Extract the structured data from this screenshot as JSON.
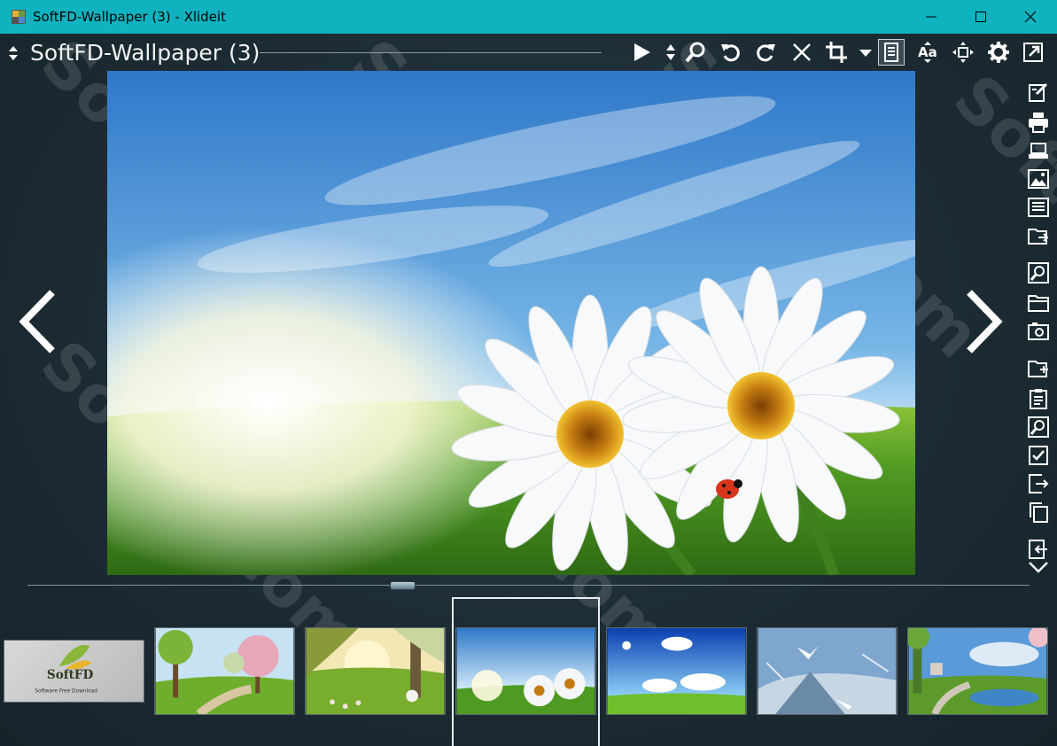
{
  "window": {
    "title": "SoftFD-Wallpaper (3) - Xlideit",
    "controls": [
      "minimize-icon",
      "maximize-icon",
      "close-icon"
    ]
  },
  "header": {
    "album_title": "SoftFD-Wallpaper (3)"
  },
  "toolbar": {
    "icons": [
      "play-icon",
      "sort-updown-icon",
      "search-icon",
      "rotate-left-icon",
      "rotate-right-icon",
      "delete-icon",
      "crop-icon",
      "dropdown-icon",
      "fit-page-icon",
      "font-size-icon",
      "move-center-icon",
      "settings-icon",
      "fullscreen-icon"
    ]
  },
  "side_toolbar": {
    "icons": [
      "edit-icon",
      "print-icon",
      "scanner-icon",
      "image-icon",
      "list-icon",
      "export-folder-icon",
      "find-file-icon",
      "open-folder-icon",
      "camera-icon",
      "copy-folder-icon",
      "clipboard-icon",
      "zoom-icon",
      "checkbox-icon",
      "move-out-icon",
      "duplicate-icon",
      "import-icon",
      "chevron-down-icon"
    ]
  },
  "thumbnails": {
    "logo_brand": "SoftFD",
    "logo_tagline": "Software Free Download",
    "selected_index": 3
  },
  "watermark": "SoftFD.com",
  "colors": {
    "titlebar": "#0fb3bf",
    "background": "#1d2b33",
    "accent": "#e8eef0"
  }
}
